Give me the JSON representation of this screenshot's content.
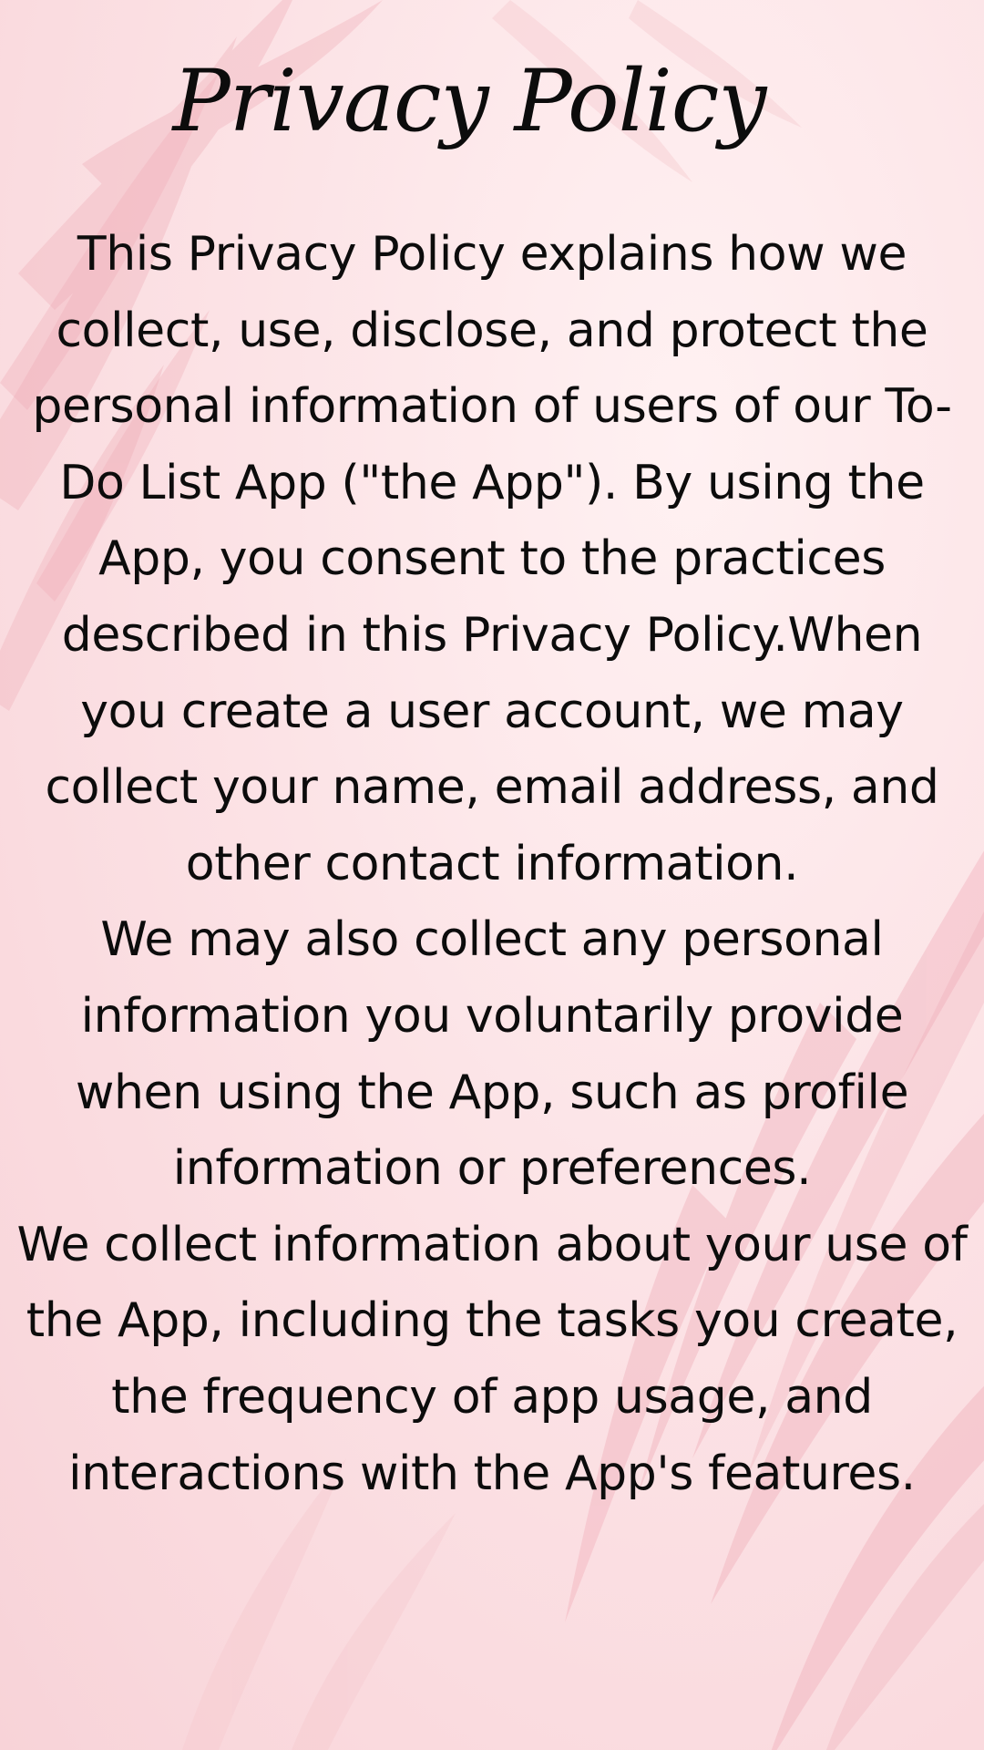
{
  "document": {
    "title": "Privacy Policy",
    "paragraphs": [
      "This Privacy Policy explains how we collect, use, disclose, and protect the personal information of users of our To-Do List App (\"the App\"). By using the App, you consent to the practices described in this Privacy Policy.When you create a user account, we may collect your name, email address, and other contact information.",
      "We may also collect any personal information you voluntarily provide when using the App, such as profile information or preferences.",
      "We collect information about your use of the App, including the tasks you create, the frequency of app usage, and interactions with the App's features."
    ]
  },
  "colors": {
    "background": "#fbe4e6",
    "leaf": "#f2b8c0",
    "text": "#0c0c0c"
  }
}
